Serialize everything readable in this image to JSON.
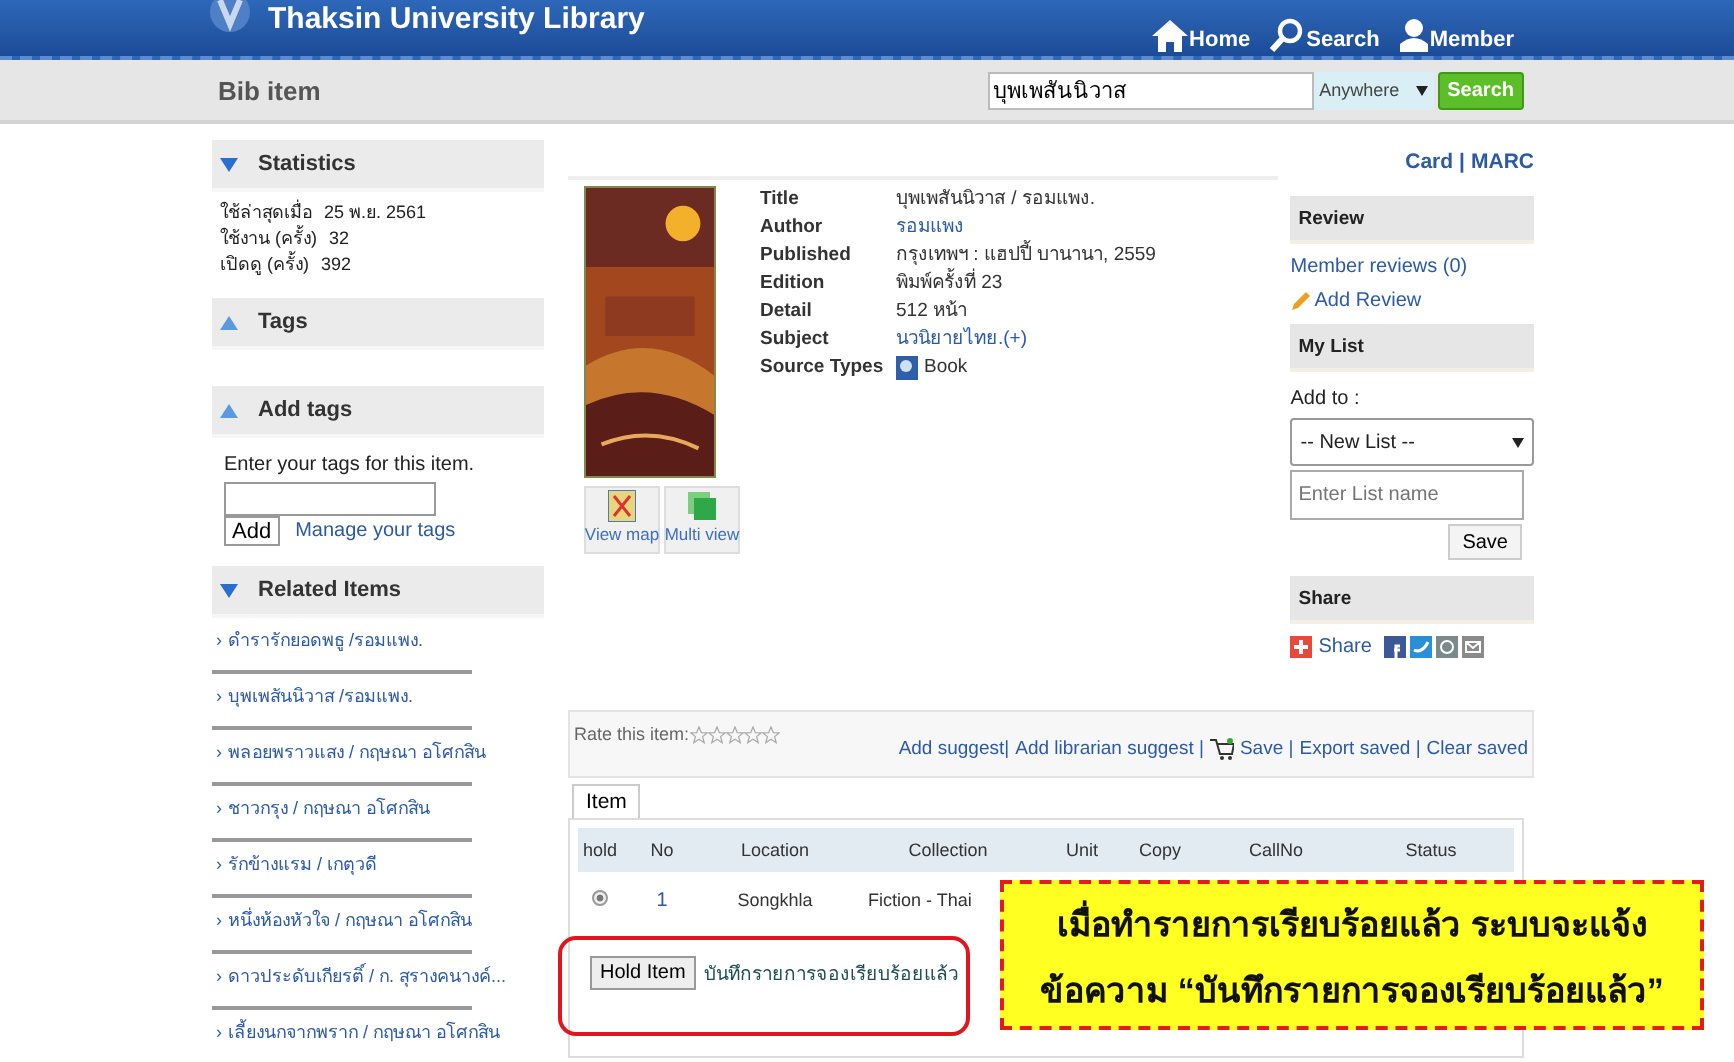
{
  "header": {
    "title": "Thaksin University Library",
    "nav": [
      "Home",
      "Search",
      "Member"
    ]
  },
  "toolbar": {
    "page_title": "Bib item",
    "search_value": "บุพเพสันนิวาส",
    "scope": "Anywhere",
    "search_button": "Search"
  },
  "sidebar": [
    {
      "kind": "stats",
      "title": "Statistics",
      "expanded": true,
      "rows": [
        {
          "label": "ใช้ล่าสุดเมื่อ",
          "value": "25 พ.ย. 2561"
        },
        {
          "label": "ใช้งาน (ครั้ง)",
          "value": "32"
        },
        {
          "label": "เปิดดู (ครั้ง)",
          "value": "392"
        }
      ]
    },
    {
      "kind": "empty",
      "title": "Tags",
      "expanded": false
    },
    {
      "kind": "addtags",
      "title": "Add tags",
      "expanded": false,
      "hint": "Enter your tags for this item.",
      "button": "Add",
      "link": "Manage your tags"
    },
    {
      "kind": "related",
      "title": "Related Items",
      "expanded": true,
      "bullet": "›",
      "items": [
        "ดำรารักยอดพธู /รอมแพง.",
        "บุพเพสันนิวาส /รอมแพง.",
        "พลอยพราวแสง / กฤษณา อโศกสิน",
        "ชาวกรุง / กฤษณา อโศกสิน",
        "รักข้างแรม / เกตุวดี",
        "หนึ่งห้องหัวใจ / กฤษณา อโศกสิน",
        "ดาวประดับเกียรติ์ / ก. สุรางคนางค์...",
        "เลี้ยงนกจากพราก / กฤษณา อโศกสิน"
      ]
    }
  ],
  "record": {
    "views": [
      "Card",
      "MARC"
    ],
    "views_separator": "|",
    "cover": {
      "kind": "picture"
    },
    "cover_buttons": [
      "View map",
      "Multi view"
    ],
    "fields": [
      {
        "label": "Title",
        "value": "บุพเพสันนิวาส / รอมแพง.",
        "link": false
      },
      {
        "label": "Author",
        "value": "รอมแพง",
        "link": true
      },
      {
        "label": "Published",
        "value": "กรุงเทพฯ : แฮปปี้ บานานา, 2559",
        "link": false
      },
      {
        "label": "Edition",
        "value": "พิมพ์ครั้งที่ 23",
        "link": false
      },
      {
        "label": "Detail",
        "value": "512 หน้า",
        "link": false
      },
      {
        "label": "Subject",
        "value": "นวนิยายไทย.(+)",
        "link": true
      },
      {
        "label": "Source Types",
        "value": "Book",
        "link": false
      }
    ]
  },
  "right_panel": {
    "review": {
      "title": "Review",
      "member_reviews": "Member reviews (0)",
      "add_review": "Add Review"
    },
    "my_list": {
      "title": "My List",
      "add_to": "Add to :",
      "select": "-- New List --",
      "placeholder": "Enter List name",
      "save": "Save"
    },
    "share": {
      "title": "Share",
      "label": "Share"
    }
  },
  "rating": {
    "label": "Rate this item:",
    "stars": 0,
    "actions": [
      "Add suggest|",
      "Add librarian suggest |",
      "Save |",
      "Export saved |",
      "Clear saved"
    ]
  },
  "items": {
    "tabs": [
      {
        "label": "Item",
        "selected": true
      }
    ],
    "columns": [
      "hold",
      "No",
      "Location",
      "Collection",
      "Unit",
      "Copy",
      "CallNo",
      "Status"
    ],
    "rows": [
      {
        "selected": true,
        "no": "1",
        "location": "Songkhla",
        "collection": "Fiction - Thai"
      }
    ],
    "hold_button": "Hold Item",
    "message": "บันทึกรายการจองเรียบร้อยแล้ว"
  },
  "callout": {
    "lines": [
      "เมื่อทำรายการเรียบร้อยแล้ว ระบบจะแจ้ง",
      "ข้อความ “บันทึกรายการจองเรียบร้อยแล้ว”"
    ]
  }
}
